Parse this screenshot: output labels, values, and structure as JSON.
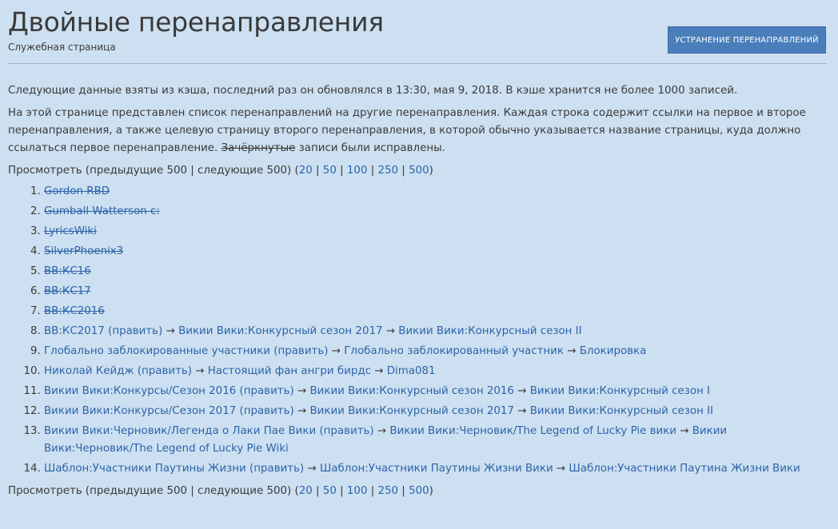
{
  "header": {
    "title": "Двойные перенаправления",
    "subtitle": "Служебная страница",
    "fix_button": "УСТРАНЕНИЕ ПЕРЕНАПРАВЛЕНИЙ"
  },
  "intro": {
    "cache_note": "Следующие данные взяты из кэша, последний раз он обновлялся в 13:30, мая 9, 2018. В кэше хранится не более 1000 записей.",
    "description_before": "На этой странице представлен список перенаправлений на другие перенаправления. Каждая строка содержит ссылки на первое и второе перенаправления, а также целевую страницу второго перенаправления, в которой обычно указывается название страницы, куда должно ссылаться первое перенаправление.",
    "struck_word": "Зачёркнутые",
    "description_after": "записи были исправлены."
  },
  "pagination": {
    "prefix": "Просмотреть (предыдущие 500 | следующие 500) (",
    "limits": [
      "20",
      "50",
      "100",
      "250",
      "500"
    ],
    "suffix": ")"
  },
  "arrow": "→",
  "edit_label": "(править)",
  "items": [
    {
      "struck": true,
      "page": "Gordon RBD"
    },
    {
      "struck": true,
      "page": "Gumball Watterson c:"
    },
    {
      "struck": true,
      "page": "LyricsWiki"
    },
    {
      "struck": true,
      "page": "SilverPhoenix3"
    },
    {
      "struck": true,
      "page": "ВВ:КС16"
    },
    {
      "struck": true,
      "page": "ВВ:КС17"
    },
    {
      "struck": true,
      "page": "ВВ:КС2016"
    },
    {
      "struck": false,
      "page": "ВВ:КС2017",
      "second": "Викии Вики:Конкурсный сезон 2017",
      "target": "Викии Вики:Конкурсный сезон II"
    },
    {
      "struck": false,
      "page": "Глобально заблокированные участники",
      "second": "Глобально заблокированный участник",
      "target": "Блокировка"
    },
    {
      "struck": false,
      "page": "Николай Кейдж",
      "second": "Настоящий фан ангри бирдс",
      "target": "Dima081"
    },
    {
      "struck": false,
      "page": "Викии Вики:Конкурсы/Сезон 2016",
      "second": "Викии Вики:Конкурсный сезон 2016",
      "target": "Викии Вики:Конкурсный сезон I"
    },
    {
      "struck": false,
      "page": "Викии Вики:Конкурсы/Сезон 2017",
      "second": "Викии Вики:Конкурсный сезон 2017",
      "target": "Викии Вики:Конкурсный сезон II"
    },
    {
      "struck": false,
      "page": "Викии Вики:Черновик/Легенда о Лаки Пае Вики",
      "second": "Викии Вики:Черновик/The Legend of Lucky Pie вики",
      "target": "Викии Вики:Черновик/The Legend of Lucky Pie Wiki"
    },
    {
      "struck": false,
      "page": "Шаблон:Участники Паутины Жизни",
      "second": "Шаблон:Участники Паутины Жизни Вики",
      "target": "Шаблон:Участники Паутина Жизни Вики"
    }
  ]
}
